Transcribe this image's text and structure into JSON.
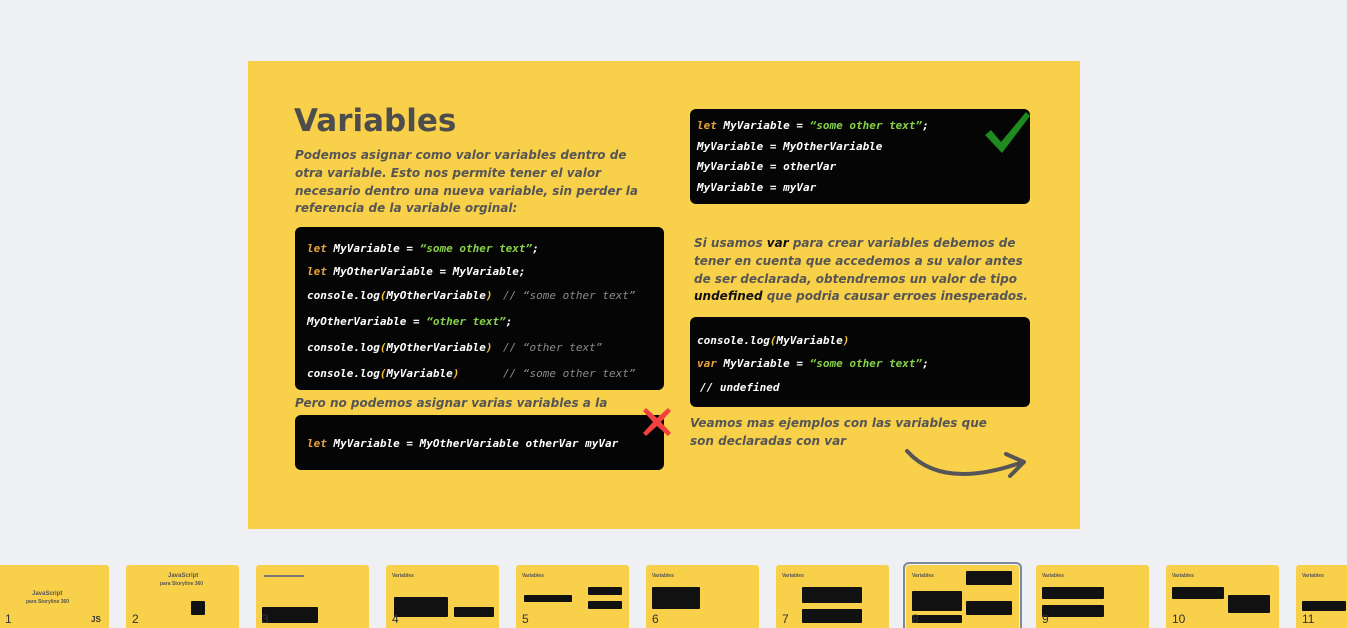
{
  "slide": {
    "title": "Variables",
    "intro": "Podemos asignar como valor variables dentro de otra variable. Esto nos permite tener el valor necesario dentro una nueva variable, sin perder la referencia de la variable orginal:",
    "code1": {
      "line1": {
        "kw": "let",
        "text": " MyVariable = ",
        "str": "“some other text”",
        "end": ";"
      },
      "line2": {
        "kw": "let",
        "text": " MyOtherVariable = MyVariable;"
      },
      "line3": {
        "fn": "console.log",
        "open": "(",
        "arg": "MyOtherVariable",
        "close": ")",
        "comment": "// “some other text”"
      },
      "line4": {
        "text": "MyOtherVariable = ",
        "str": "“other text”",
        "end": ";"
      },
      "line5": {
        "fn": "console.log",
        "open": "(",
        "arg": "MyOtherVariable",
        "close": ")",
        "comment": "// “other text”"
      },
      "line6": {
        "fn": "console.log",
        "open": "(",
        "arg": "MyVariable",
        "close": ")",
        "comment": "// “some other text”"
      }
    },
    "warning": "Pero no podemos asignar varias variables a la vez:",
    "code2": {
      "kw": "let",
      "text": " MyVariable = MyOtherVariable otherVar myVar"
    },
    "code3": {
      "line1": {
        "kw": "let",
        "text": " MyVariable = ",
        "str": "“some other text”",
        "end": ";"
      },
      "line2": "MyVariable = MyOtherVariable",
      "line3": "MyVariable = otherVar",
      "line4": "MyVariable = myVar"
    },
    "var_note": {
      "a": "Si usamos ",
      "var": "var",
      "b": "  para crear variables debemos de tener en cuenta que accedemos a su valor antes de ser declarada, obtendremos un valor de tipo ",
      "undefined": "undefined",
      "c": " que podria causar erroes inesperados."
    },
    "code4": {
      "line1": {
        "fn": "console.log",
        "open": "(",
        "arg": "MyVariable",
        "close": ")"
      },
      "line2": {
        "kw": "var",
        "text": " MyVariable = ",
        "str": "“some other text”",
        "end": ";"
      },
      "line3": "// undefined"
    },
    "outro": "Veamos mas ejemplos con las variables que son declaradas con var"
  },
  "filmstrip": {
    "selected": 8,
    "thumbs": [
      {
        "num": "1",
        "title": "JavaScript",
        "sub": "para Storyline 360",
        "badge": "JS"
      },
      {
        "num": "2",
        "title": "JavaScript",
        "sub": "para Storyline 360"
      },
      {
        "num": "3"
      },
      {
        "num": "4",
        "title": "Variables"
      },
      {
        "num": "5",
        "title": "Variables"
      },
      {
        "num": "6",
        "title": "Variables"
      },
      {
        "num": "7",
        "title": "Variables"
      },
      {
        "num": "8",
        "title": "Variables"
      },
      {
        "num": "9",
        "title": "Variables"
      },
      {
        "num": "10",
        "title": "Variables"
      },
      {
        "num": "11",
        "title": "Variables"
      }
    ]
  },
  "colors": {
    "slide_bg": "#f9d04a",
    "code_bg": "#050505",
    "keyword": "#e8a23e",
    "string": "#86d14a",
    "check": "#1f8a1f",
    "cross": "#f0413e"
  }
}
